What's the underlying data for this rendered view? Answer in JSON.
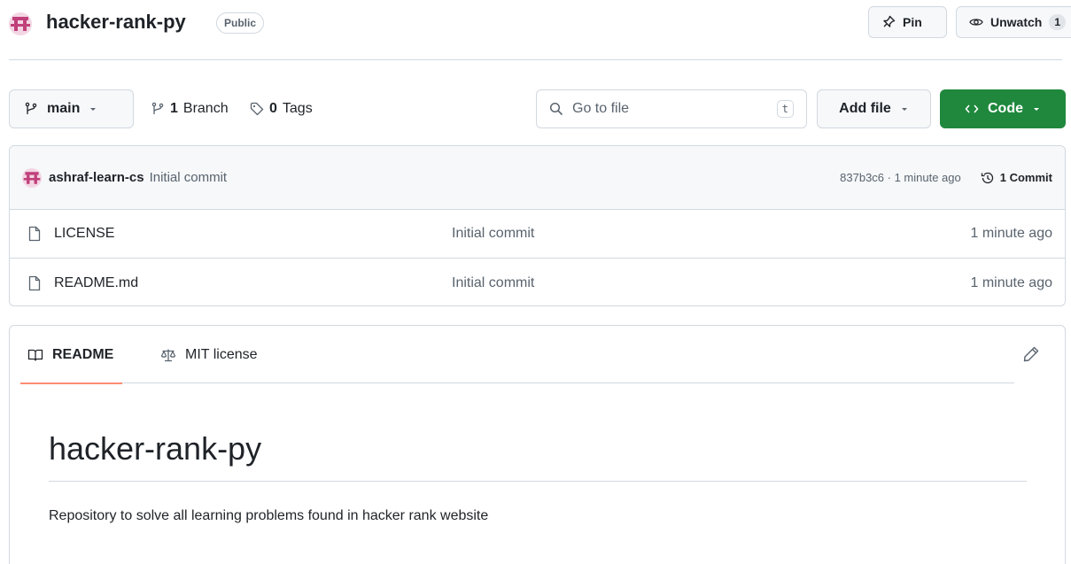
{
  "header": {
    "repo_name": "hacker-rank-py",
    "visibility": "Public",
    "pin_label": "Pin",
    "unwatch_label": "Unwatch",
    "unwatch_count": "1"
  },
  "toolbar": {
    "branch_name": "main",
    "branch_count": "1",
    "branch_label": "Branch",
    "tag_count": "0",
    "tag_label": "Tags",
    "goto_placeholder": "Go to file",
    "goto_shortcut": "t",
    "add_file_label": "Add file",
    "code_label": "Code"
  },
  "latest_commit": {
    "author": "ashraf-learn-cs",
    "message": "Initial commit",
    "meta": "837b3c6 · 1 minute ago",
    "count_label": "1 Commit"
  },
  "files": [
    {
      "name": "LICENSE",
      "message": "Initial commit",
      "time": "1 minute ago"
    },
    {
      "name": "README.md",
      "message": "Initial commit",
      "time": "1 minute ago"
    }
  ],
  "readme": {
    "tab_readme": "README",
    "tab_license": "MIT license",
    "heading": "hacker-rank-py",
    "body": "Repository to solve all learning problems found in hacker rank website"
  },
  "colors": {
    "code_button": "#1f883d",
    "active_tab_underline": "#fd8c73",
    "avatar": "#c0407a"
  }
}
